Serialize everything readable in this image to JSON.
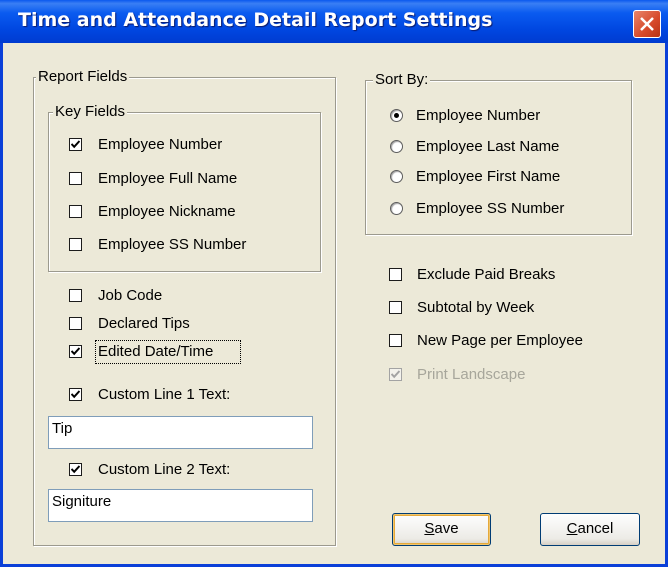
{
  "window": {
    "title": "Time and Attendance Detail Report Settings"
  },
  "report_fields": {
    "legend": "Report Fields",
    "key_fields": {
      "legend": "Key Fields",
      "items": [
        {
          "label": "Employee Number",
          "checked": true
        },
        {
          "label": "Employee Full Name",
          "checked": false
        },
        {
          "label": "Employee Nickname",
          "checked": false
        },
        {
          "label": "Employee SS Number",
          "checked": false
        }
      ]
    },
    "other_fields": [
      {
        "label": "Job Code",
        "checked": false
      },
      {
        "label": "Declared Tips",
        "checked": false
      },
      {
        "label": "Edited Date/Time",
        "checked": true
      }
    ],
    "custom_line_1": {
      "label": "Custom Line 1 Text:",
      "checked": true,
      "value": "Tip"
    },
    "custom_line_2": {
      "label": "Custom Line 2 Text:",
      "checked": true,
      "value": "Signiture"
    }
  },
  "sort_by": {
    "legend": "Sort By:",
    "options": [
      {
        "label": "Employee Number",
        "selected": true
      },
      {
        "label": "Employee Last Name",
        "selected": false
      },
      {
        "label": "Employee First Name",
        "selected": false
      },
      {
        "label": "Employee SS Number",
        "selected": false
      }
    ]
  },
  "options": [
    {
      "label": "Exclude Paid Breaks",
      "checked": false,
      "enabled": true
    },
    {
      "label": "Subtotal by Week",
      "checked": false,
      "enabled": true
    },
    {
      "label": "New Page per Employee",
      "checked": false,
      "enabled": true
    },
    {
      "label": "Print Landscape",
      "checked": true,
      "enabled": false
    }
  ],
  "buttons": {
    "save": {
      "mnemonic": "S",
      "rest": "ave"
    },
    "cancel": {
      "mnemonic": "C",
      "rest": "ancel"
    }
  },
  "colors": {
    "titlebar": "#0054e3",
    "dialog_bg": "#ece9d8",
    "close_button": "#d6492a",
    "disabled_text": "#a7a69b"
  }
}
